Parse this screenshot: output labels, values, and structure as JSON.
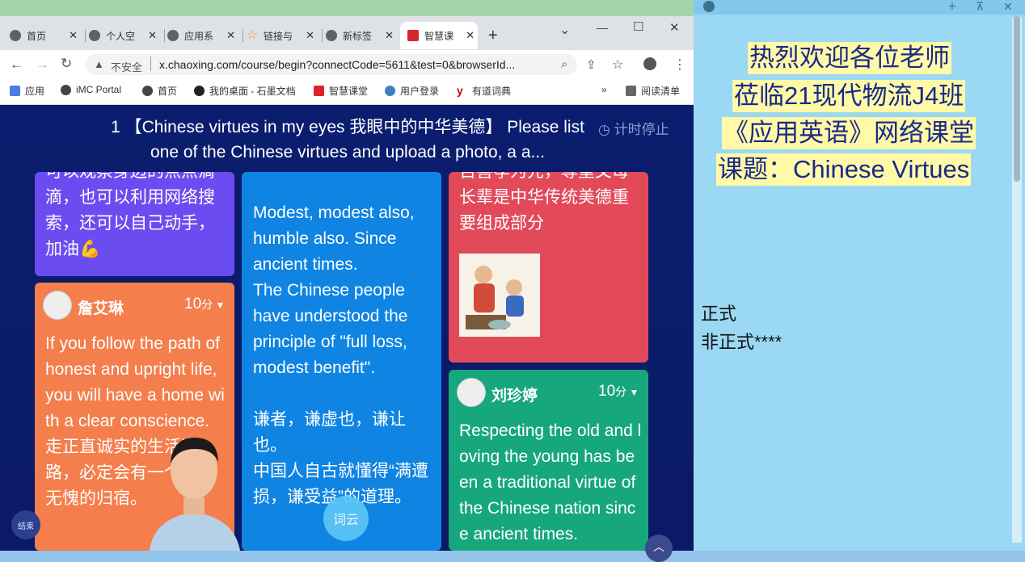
{
  "tabs": [
    {
      "label": "首页",
      "close": "✕"
    },
    {
      "label": "个人空",
      "close": "✕"
    },
    {
      "label": "应用系",
      "close": "✕"
    },
    {
      "label": "链接与",
      "close": "✕"
    },
    {
      "label": "新标签",
      "close": "✕"
    },
    {
      "label": "智慧课",
      "close": "✕"
    }
  ],
  "window_controls": {
    "dropdown": "⌄",
    "minimize": "—",
    "maximize": "☐",
    "close": "✕",
    "newtab": "+"
  },
  "address": {
    "security": "不安全",
    "url": "x.chaoxing.com/course/begin?connectCode=5611&test=0&browserId..."
  },
  "bookmarks": [
    {
      "label": "应用"
    },
    {
      "label": "iMC Portal"
    },
    {
      "label": "首页"
    },
    {
      "label": "我的桌面 - 石墨文档"
    },
    {
      "label": "智慧课堂"
    },
    {
      "label": "用户登录"
    },
    {
      "label": "有道词典"
    }
  ],
  "bookmarks_more": "»",
  "reading_list": "阅读清单",
  "question": {
    "title": "1 【Chinese virtues in my eyes 我眼中的中华美德】 Please list one of the Chinese virtues and upload a photo, a a...",
    "timer": "计时停止"
  },
  "cards": {
    "purple": {
      "text": "可以观察身边的点点滴滴，也可以利用网络搜索，还可以自己动手，加油💪"
    },
    "orange": {
      "name": "詹艾琳",
      "score": "10",
      "unit": "分",
      "text": "If you follow the path of honest and upright life, you will have a home with a clear conscience.\n走正直诚实的生活道路，必定会有一个问心无愧的归宿。"
    },
    "blue": {
      "text": "Modest, modest also, humble also. Since ancient times.\nThe Chinese people have understood the principle of \"full loss, modest benefit\".\n\n谦者，谦虚也，谦让也。\n中国人自古就懂得“满遭损，谦受益”的道理。"
    },
    "red": {
      "text": "百善孝为先，尊重父母长辈是中华传统美德重要组成部分"
    },
    "green": {
      "name": "刘珍婷",
      "score": "10",
      "unit": "分",
      "text": "Respecting the old and loving the young has been a traditional virtue of the Chinese nation since ancient times."
    }
  },
  "buttons": {
    "end": "结束",
    "wordcloud": "词云",
    "up": "︿"
  },
  "right_panel": {
    "lines": [
      "热烈欢迎各位老师",
      "莅临21现代物流J4班",
      "《应用英语》网络课堂",
      "课题：Chinese Virtues"
    ],
    "note1": "正式",
    "note2": "非正式****",
    "controls": {
      "add": "+",
      "pin": "⊼",
      "close": "✕"
    }
  },
  "colors": {
    "purple": "#6b4cf0",
    "orange": "#f47e4c",
    "blue": "#0f84e2",
    "red": "#e24a5a",
    "green": "#17a77c",
    "background": "#0a1a66"
  }
}
